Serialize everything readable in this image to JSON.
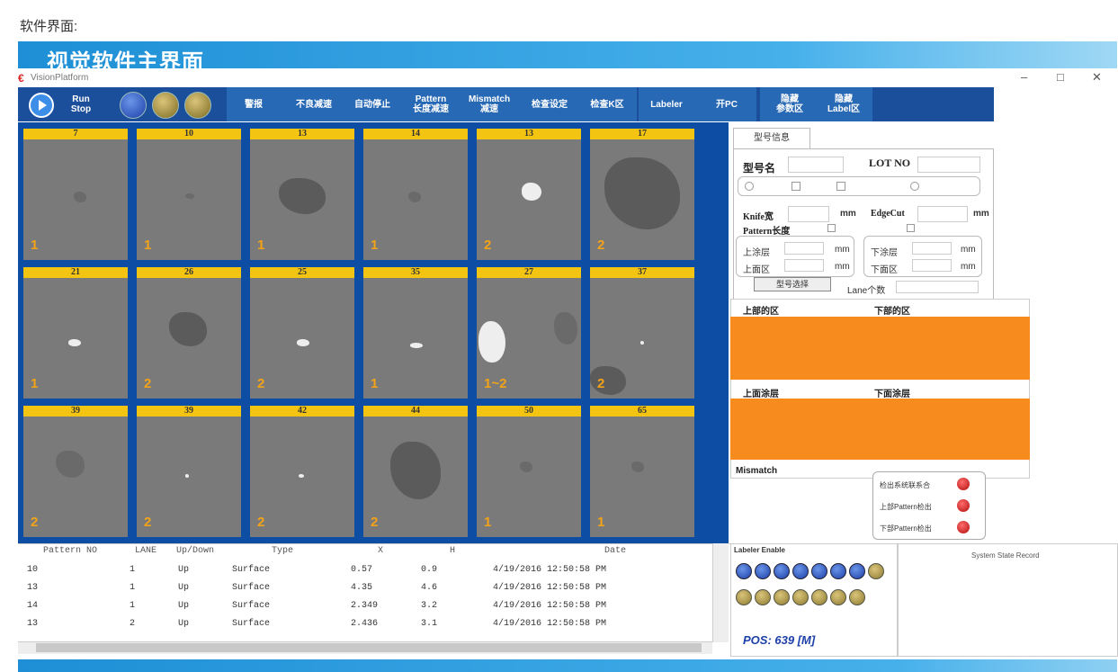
{
  "caption": "软件界面:",
  "banner_title": "视觉软件主界面",
  "app": {
    "title": "VisionPlatform",
    "window_controls": [
      "–",
      "□",
      "✕"
    ]
  },
  "toolbar": {
    "run_stop": "Run\nStop",
    "buttons": [
      "警报",
      "不良减速",
      "自动停止",
      "Pattern\n长度减速",
      "Mismatch\n减速",
      "检查设定",
      "检查K区",
      "Labeler",
      "开PC",
      "隐藏\n参数区",
      "隐藏\nLabel区"
    ]
  },
  "gallery": {
    "cells": [
      {
        "id": "7",
        "count": "1"
      },
      {
        "id": "10",
        "count": "1"
      },
      {
        "id": "13",
        "count": "1"
      },
      {
        "id": "14",
        "count": "1"
      },
      {
        "id": "13",
        "count": "2"
      },
      {
        "id": "17",
        "count": "2"
      },
      {
        "id": "21",
        "count": "1"
      },
      {
        "id": "26",
        "count": "2"
      },
      {
        "id": "25",
        "count": "2"
      },
      {
        "id": "35",
        "count": "1"
      },
      {
        "id": "27",
        "count": "1~2"
      },
      {
        "id": "37",
        "count": "2"
      },
      {
        "id": "39",
        "count": "2"
      },
      {
        "id": "39",
        "count": "2"
      },
      {
        "id": "42",
        "count": "2"
      },
      {
        "id": "44",
        "count": "2"
      },
      {
        "id": "50",
        "count": "1"
      },
      {
        "id": "65",
        "count": "1"
      }
    ]
  },
  "settings": {
    "tab": "型号信息",
    "model_label": "型号名",
    "lot_label": "LOT NO",
    "knife_label": "Knife宽",
    "edgecut_label": "EdgeCut",
    "unit_mm": "mm",
    "pattern_label": "Pattern长度",
    "upper_label_1": "上涂层",
    "upper_label_2": "上面区",
    "lower_label_1": "下涂层",
    "lower_label_2": "下面区",
    "save_button": "型号选择",
    "lane_label": "Lane个数"
  },
  "defects": {
    "upper_zone": "上部的区",
    "lower_zone": "下部的区",
    "upper_defect": "上面涂层",
    "lower_defect": "下面涂层",
    "mismatch": "Mismatch"
  },
  "status_lights": {
    "items": [
      "检出系统联系合",
      "上部Pattern检出",
      "下部Pattern检出"
    ]
  },
  "table": {
    "headers": [
      "Pattern NO",
      "LANE",
      "Up/Down",
      "Type",
      "X",
      "H",
      "Date"
    ],
    "rows": [
      [
        "10",
        "1",
        "Up",
        "Surface",
        "0.57",
        "0.9",
        "4/19/2016 12:50:58 PM"
      ],
      [
        "13",
        "1",
        "Up",
        "Surface",
        "4.35",
        "4.6",
        "4/19/2016 12:50:58 PM"
      ],
      [
        "14",
        "1",
        "Up",
        "Surface",
        "2.349",
        "3.2",
        "4/19/2016 12:50:58 PM"
      ],
      [
        "13",
        "2",
        "Up",
        "Surface",
        "2.436",
        "3.1",
        "4/19/2016 12:50:58 PM"
      ]
    ]
  },
  "labeler": {
    "title": "Labeler Enable",
    "pos": "POS: 639 [M]"
  },
  "system_record": {
    "title": "System State Record"
  }
}
